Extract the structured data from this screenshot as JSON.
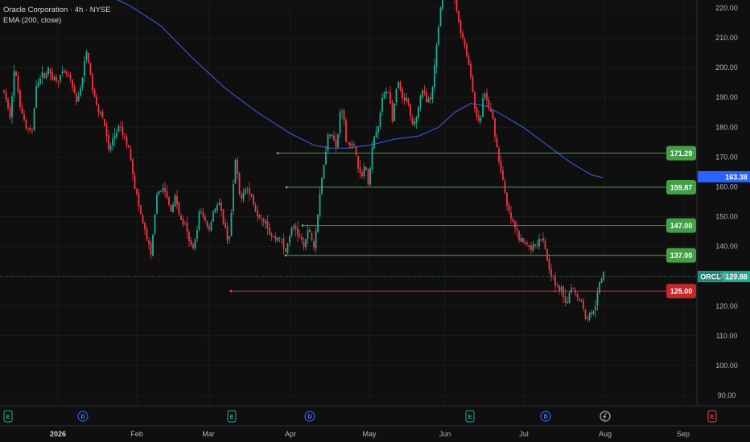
{
  "legend": {
    "title": "Oracle Corporation · 4h · NYSE",
    "indicator": "EMA (200, close)"
  },
  "colors": {
    "background": "#0f0f0f",
    "up": "#22ab94",
    "down": "#f23645",
    "ema": "#3557c9",
    "support": "#4caf50",
    "support_tag": "#43a047",
    "resistance": "#f23645",
    "resistance_tag": "#c62828",
    "price_tag": "#22ab94",
    "ema_tag": "#2962ff"
  },
  "chart_data": {
    "type": "candlestick",
    "symbol": "ORCL",
    "ylim": [
      85,
      225
    ],
    "y_ticks": [
      "220.00",
      "210.00",
      "200.00",
      "190.00",
      "180.00",
      "170.00",
      "160.00",
      "150.00",
      "140.00",
      "130.00",
      "120.00",
      "110.00",
      "100.00",
      "90.00"
    ],
    "x_labels": [
      {
        "label": "2026",
        "bold": true,
        "x": 72
      },
      {
        "label": "Feb",
        "x": 170
      },
      {
        "label": "Mar",
        "x": 259
      },
      {
        "label": "Apr",
        "x": 361
      },
      {
        "label": "May",
        "x": 459
      },
      {
        "label": "Jun",
        "x": 553
      },
      {
        "label": "Jul",
        "x": 651
      },
      {
        "label": "Aug",
        "x": 752
      },
      {
        "label": "Sep",
        "x": 849
      }
    ],
    "events": [
      {
        "type": "E",
        "x": 10
      },
      {
        "type": "D",
        "x": 103
      },
      {
        "type": "E",
        "x": 288
      },
      {
        "type": "D",
        "x": 385
      },
      {
        "type": "E",
        "x": 584
      },
      {
        "type": "D",
        "x": 678
      },
      {
        "type": "S",
        "x": 752
      },
      {
        "type": "E",
        "x": 885
      }
    ],
    "price_path": [
      [
        5,
        192
      ],
      [
        12,
        183
      ],
      [
        18,
        200
      ],
      [
        25,
        188
      ],
      [
        32,
        180
      ],
      [
        40,
        178
      ],
      [
        45,
        195
      ],
      [
        52,
        197
      ],
      [
        60,
        199
      ],
      [
        68,
        196
      ],
      [
        75,
        197
      ],
      [
        82,
        198
      ],
      [
        88,
        195
      ],
      [
        95,
        188
      ],
      [
        102,
        196
      ],
      [
        108,
        206
      ],
      [
        114,
        194
      ],
      [
        120,
        187
      ],
      [
        128,
        184
      ],
      [
        135,
        172
      ],
      [
        142,
        177
      ],
      [
        148,
        180
      ],
      [
        155,
        176
      ],
      [
        162,
        171
      ],
      [
        167,
        161
      ],
      [
        172,
        154
      ],
      [
        178,
        147
      ],
      [
        183,
        142
      ],
      [
        188,
        136
      ],
      [
        193,
        154
      ],
      [
        199,
        160
      ],
      [
        205,
        158
      ],
      [
        212,
        152
      ],
      [
        218,
        157
      ],
      [
        224,
        149
      ],
      [
        230,
        147
      ],
      [
        236,
        140
      ],
      [
        242,
        141
      ],
      [
        248,
        152
      ],
      [
        254,
        149
      ],
      [
        260,
        146
      ],
      [
        266,
        153
      ],
      [
        272,
        154
      ],
      [
        278,
        148
      ],
      [
        284,
        141
      ],
      [
        289,
        155
      ],
      [
        292,
        170
      ],
      [
        298,
        156
      ],
      [
        305,
        160
      ],
      [
        312,
        157
      ],
      [
        318,
        152
      ],
      [
        324,
        150
      ],
      [
        330,
        149
      ],
      [
        336,
        144
      ],
      [
        342,
        142
      ],
      [
        348,
        144
      ],
      [
        354,
        137
      ],
      [
        360,
        144
      ],
      [
        366,
        147
      ],
      [
        372,
        143
      ],
      [
        378,
        140
      ],
      [
        384,
        146
      ],
      [
        390,
        140
      ],
      [
        396,
        153
      ],
      [
        401,
        165
      ],
      [
        407,
        177
      ],
      [
        412,
        179
      ],
      [
        418,
        172
      ],
      [
        424,
        189
      ],
      [
        430,
        176
      ],
      [
        436,
        174
      ],
      [
        442,
        172
      ],
      [
        448,
        163
      ],
      [
        453,
        167
      ],
      [
        458,
        161
      ],
      [
        464,
        176
      ],
      [
        470,
        180
      ],
      [
        476,
        191
      ],
      [
        482,
        193
      ],
      [
        488,
        182
      ],
      [
        494,
        196
      ],
      [
        500,
        189
      ],
      [
        506,
        189
      ],
      [
        512,
        180
      ],
      [
        518,
        184
      ],
      [
        524,
        192
      ],
      [
        530,
        190
      ],
      [
        536,
        188
      ],
      [
        542,
        206
      ],
      [
        548,
        222
      ],
      [
        553,
        242
      ],
      [
        559,
        230
      ],
      [
        566,
        221
      ],
      [
        572,
        213
      ],
      [
        578,
        207
      ],
      [
        584,
        199
      ],
      [
        590,
        187
      ],
      [
        596,
        180
      ],
      [
        601,
        192
      ],
      [
        607,
        187
      ],
      [
        613,
        182
      ],
      [
        619,
        170
      ],
      [
        624,
        164
      ],
      [
        629,
        154
      ],
      [
        634,
        150
      ],
      [
        640,
        146
      ],
      [
        646,
        142
      ],
      [
        652,
        141
      ],
      [
        658,
        140
      ],
      [
        664,
        140
      ],
      [
        670,
        143
      ],
      [
        675,
        143
      ],
      [
        680,
        136
      ],
      [
        686,
        130
      ],
      [
        692,
        126
      ],
      [
        698,
        125
      ],
      [
        704,
        121
      ],
      [
        710,
        127
      ],
      [
        716,
        124
      ],
      [
        722,
        122
      ],
      [
        728,
        116
      ],
      [
        734,
        117
      ],
      [
        740,
        121
      ],
      [
        746,
        128
      ],
      [
        750,
        131
      ]
    ],
    "ema_200": [
      [
        120,
        226
      ],
      [
        160,
        221
      ],
      [
        200,
        214
      ],
      [
        240,
        203
      ],
      [
        280,
        193
      ],
      [
        320,
        185
      ],
      [
        360,
        178
      ],
      [
        390,
        174
      ],
      [
        410,
        173
      ],
      [
        430,
        173
      ],
      [
        460,
        174
      ],
      [
        490,
        176
      ],
      [
        520,
        177
      ],
      [
        545,
        180
      ],
      [
        565,
        185
      ],
      [
        585,
        188
      ],
      [
        605,
        187
      ],
      [
        625,
        184
      ],
      [
        650,
        180
      ],
      [
        680,
        174
      ],
      [
        710,
        168
      ],
      [
        735,
        164
      ],
      [
        750,
        163
      ]
    ],
    "levels": [
      {
        "label": "171.29",
        "value": 171.29,
        "x_start": 345,
        "kind": "support"
      },
      {
        "label": "159.87",
        "value": 159.87,
        "x_start": 356,
        "kind": "support"
      },
      {
        "label": "147.00",
        "value": 147.0,
        "x_start": 376,
        "kind": "support"
      },
      {
        "label": "137.00",
        "value": 137.0,
        "x_start": 355,
        "kind": "support"
      },
      {
        "label": "125.00",
        "value": 125.0,
        "x_start": 287,
        "kind": "resistance"
      }
    ],
    "current_price": {
      "symbol": "ORCL",
      "value": 129.88,
      "label": "129.88"
    },
    "ema_last": {
      "value": 163.38,
      "label": "163.38"
    }
  }
}
